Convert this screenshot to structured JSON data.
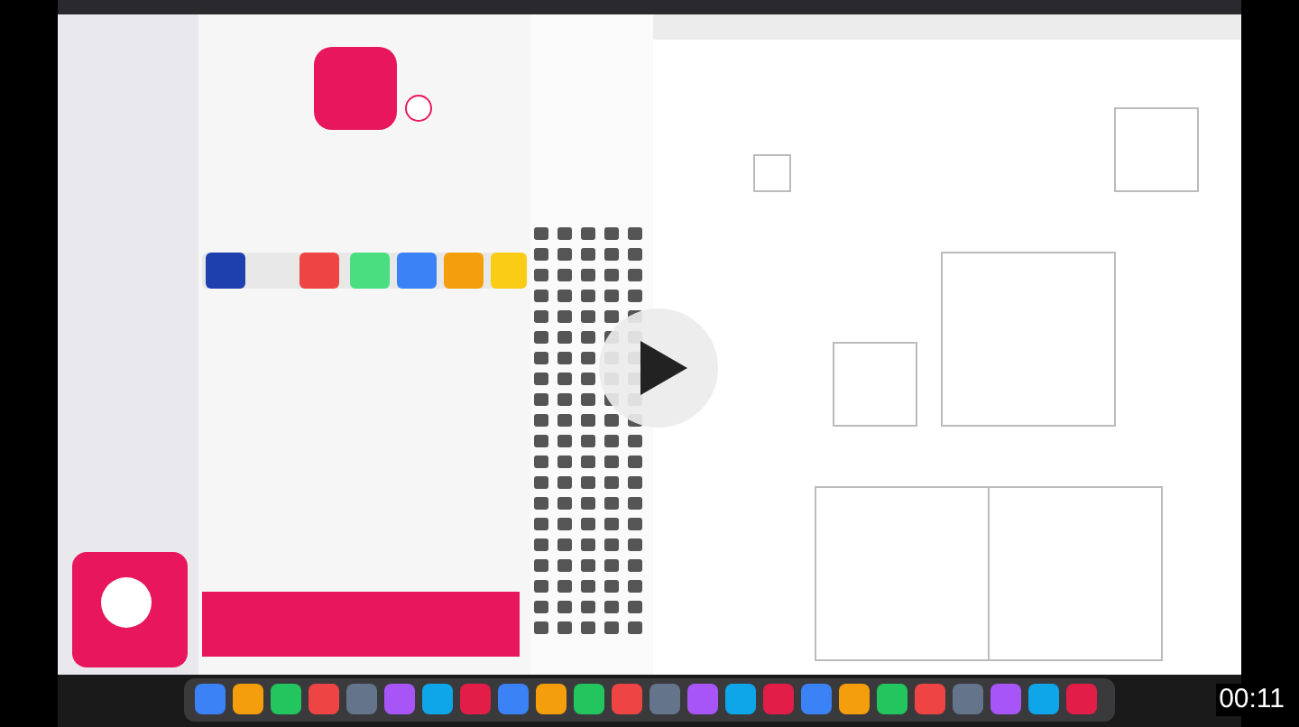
{
  "video": {
    "playing": false,
    "time": "00:11"
  }
}
